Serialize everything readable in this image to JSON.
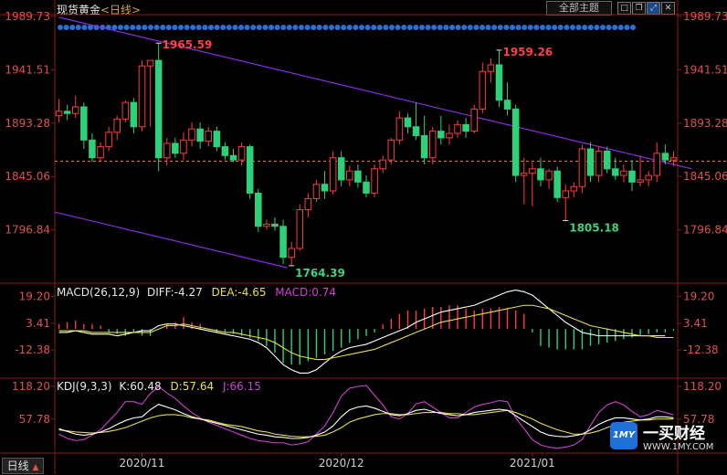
{
  "header": {
    "title": "现货黄金",
    "period": "<日线>",
    "theme_button": "全部主题",
    "icons": [
      "square-icon",
      "restore-icon",
      "maximize-icon",
      "close-icon"
    ]
  },
  "footer": {
    "period_button": "日线",
    "period_arrow": "▲"
  },
  "colors": {
    "up": "#ff3b3b",
    "down": "#2ed07a",
    "price_text": "#e05050",
    "grid": "#8b1a1a",
    "diff": "#ffffff",
    "dea": "#e8e040",
    "macd": "#d040d0",
    "k": "#ffffff",
    "d": "#e8e040",
    "j": "#d040d0",
    "channel": "#8a2be2"
  },
  "chart_data": {
    "type": "candlestick",
    "main": {
      "title": "现货黄金",
      "y_ticks": [
        "1989.73",
        "1941.51",
        "1893.28",
        "1845.06",
        "1796.84"
      ],
      "ylim": [
        1748.62,
        1989.73
      ],
      "dashed_level": 1859,
      "annotations": [
        {
          "text": "1965.59",
          "value": 1965.59,
          "color": "#ff4040"
        },
        {
          "text": "1764.39",
          "value": 1764.39,
          "color": "#40d080"
        },
        {
          "text": "1959.26",
          "value": 1959.26,
          "color": "#ff4040"
        },
        {
          "text": "1805.18",
          "value": 1805.18,
          "color": "#40d080"
        }
      ],
      "candles": [
        {
          "o": 1900,
          "h": 1915,
          "l": 1894,
          "c": 1904
        },
        {
          "o": 1904,
          "h": 1910,
          "l": 1896,
          "c": 1902
        },
        {
          "o": 1902,
          "h": 1918,
          "l": 1898,
          "c": 1908
        },
        {
          "o": 1908,
          "h": 1912,
          "l": 1870,
          "c": 1878
        },
        {
          "o": 1878,
          "h": 1884,
          "l": 1858,
          "c": 1862
        },
        {
          "o": 1862,
          "h": 1876,
          "l": 1858,
          "c": 1872
        },
        {
          "o": 1872,
          "h": 1890,
          "l": 1868,
          "c": 1885
        },
        {
          "o": 1885,
          "h": 1900,
          "l": 1878,
          "c": 1897
        },
        {
          "o": 1897,
          "h": 1914,
          "l": 1894,
          "c": 1912
        },
        {
          "o": 1912,
          "h": 1916,
          "l": 1884,
          "c": 1890
        },
        {
          "o": 1890,
          "h": 1950,
          "l": 1886,
          "c": 1945
        },
        {
          "o": 1945,
          "h": 1950,
          "l": 1890,
          "c": 1950
        },
        {
          "o": 1950,
          "h": 1965.59,
          "l": 1850,
          "c": 1862
        },
        {
          "o": 1862,
          "h": 1880,
          "l": 1855,
          "c": 1875
        },
        {
          "o": 1875,
          "h": 1880,
          "l": 1862,
          "c": 1866
        },
        {
          "o": 1866,
          "h": 1885,
          "l": 1860,
          "c": 1878
        },
        {
          "o": 1878,
          "h": 1894,
          "l": 1872,
          "c": 1888
        },
        {
          "o": 1888,
          "h": 1894,
          "l": 1870,
          "c": 1877
        },
        {
          "o": 1877,
          "h": 1890,
          "l": 1872,
          "c": 1886
        },
        {
          "o": 1886,
          "h": 1890,
          "l": 1868,
          "c": 1872
        },
        {
          "o": 1872,
          "h": 1876,
          "l": 1860,
          "c": 1864
        },
        {
          "o": 1864,
          "h": 1870,
          "l": 1858,
          "c": 1860
        },
        {
          "o": 1860,
          "h": 1876,
          "l": 1855,
          "c": 1872
        },
        {
          "o": 1872,
          "h": 1874,
          "l": 1825,
          "c": 1830
        },
        {
          "o": 1830,
          "h": 1834,
          "l": 1795,
          "c": 1800
        },
        {
          "o": 1800,
          "h": 1806,
          "l": 1797,
          "c": 1802
        },
        {
          "o": 1802,
          "h": 1808,
          "l": 1796,
          "c": 1800
        },
        {
          "o": 1800,
          "h": 1806,
          "l": 1766,
          "c": 1772
        },
        {
          "o": 1772,
          "h": 1786,
          "l": 1764.39,
          "c": 1780
        },
        {
          "o": 1780,
          "h": 1820,
          "l": 1778,
          "c": 1815
        },
        {
          "o": 1815,
          "h": 1830,
          "l": 1808,
          "c": 1825
        },
        {
          "o": 1825,
          "h": 1842,
          "l": 1822,
          "c": 1838
        },
        {
          "o": 1838,
          "h": 1850,
          "l": 1825,
          "c": 1832
        },
        {
          "o": 1832,
          "h": 1868,
          "l": 1829,
          "c": 1862
        },
        {
          "o": 1862,
          "h": 1868,
          "l": 1836,
          "c": 1842
        },
        {
          "o": 1842,
          "h": 1855,
          "l": 1836,
          "c": 1850
        },
        {
          "o": 1850,
          "h": 1856,
          "l": 1835,
          "c": 1840
        },
        {
          "o": 1840,
          "h": 1846,
          "l": 1826,
          "c": 1830
        },
        {
          "o": 1830,
          "h": 1856,
          "l": 1826,
          "c": 1852
        },
        {
          "o": 1852,
          "h": 1864,
          "l": 1848,
          "c": 1860
        },
        {
          "o": 1860,
          "h": 1880,
          "l": 1856,
          "c": 1878
        },
        {
          "o": 1878,
          "h": 1904,
          "l": 1874,
          "c": 1898
        },
        {
          "o": 1898,
          "h": 1902,
          "l": 1884,
          "c": 1890
        },
        {
          "o": 1890,
          "h": 1912,
          "l": 1878,
          "c": 1882
        },
        {
          "o": 1882,
          "h": 1900,
          "l": 1856,
          "c": 1862
        },
        {
          "o": 1862,
          "h": 1890,
          "l": 1856,
          "c": 1886
        },
        {
          "o": 1886,
          "h": 1900,
          "l": 1874,
          "c": 1880
        },
        {
          "o": 1880,
          "h": 1892,
          "l": 1874,
          "c": 1884
        },
        {
          "o": 1884,
          "h": 1896,
          "l": 1880,
          "c": 1892
        },
        {
          "o": 1892,
          "h": 1898,
          "l": 1880,
          "c": 1886
        },
        {
          "o": 1886,
          "h": 1910,
          "l": 1884,
          "c": 1906
        },
        {
          "o": 1906,
          "h": 1948,
          "l": 1902,
          "c": 1940
        },
        {
          "o": 1940,
          "h": 1952,
          "l": 1930,
          "c": 1946
        },
        {
          "o": 1946,
          "h": 1959.26,
          "l": 1908,
          "c": 1914
        },
        {
          "o": 1914,
          "h": 1930,
          "l": 1900,
          "c": 1906
        },
        {
          "o": 1906,
          "h": 1910,
          "l": 1840,
          "c": 1846
        },
        {
          "o": 1846,
          "h": 1862,
          "l": 1820,
          "c": 1848
        },
        {
          "o": 1848,
          "h": 1858,
          "l": 1818,
          "c": 1852
        },
        {
          "o": 1852,
          "h": 1862,
          "l": 1836,
          "c": 1842
        },
        {
          "o": 1842,
          "h": 1852,
          "l": 1834,
          "c": 1850
        },
        {
          "o": 1850,
          "h": 1854,
          "l": 1822,
          "c": 1826
        },
        {
          "o": 1826,
          "h": 1838,
          "l": 1805.18,
          "c": 1832
        },
        {
          "o": 1832,
          "h": 1840,
          "l": 1826,
          "c": 1836
        },
        {
          "o": 1836,
          "h": 1874,
          "l": 1830,
          "c": 1870
        },
        {
          "o": 1870,
          "h": 1876,
          "l": 1840,
          "c": 1846
        },
        {
          "o": 1846,
          "h": 1872,
          "l": 1840,
          "c": 1868
        },
        {
          "o": 1868,
          "h": 1872,
          "l": 1848,
          "c": 1852
        },
        {
          "o": 1852,
          "h": 1862,
          "l": 1842,
          "c": 1846
        },
        {
          "o": 1846,
          "h": 1856,
          "l": 1840,
          "c": 1850
        },
        {
          "o": 1850,
          "h": 1860,
          "l": 1832,
          "c": 1840
        },
        {
          "o": 1840,
          "h": 1864,
          "l": 1836,
          "c": 1842
        },
        {
          "o": 1842,
          "h": 1850,
          "l": 1836,
          "c": 1846
        },
        {
          "o": 1846,
          "h": 1876,
          "l": 1840,
          "c": 1866
        },
        {
          "o": 1866,
          "h": 1874,
          "l": 1856,
          "c": 1860
        },
        {
          "o": 1860,
          "h": 1868,
          "l": 1854,
          "c": 1862
        }
      ]
    },
    "macd": {
      "title": "MACD(26,12,9)",
      "diff_label": "DIFF:-4.27",
      "dea_label": "DEA:-4.65",
      "macd_label": "MACD:0.74",
      "y_ticks": [
        "19.20",
        "3.41",
        "-12.38"
      ],
      "ylim": [
        -29,
        26
      ],
      "hist": [
        3,
        4,
        5,
        3,
        3,
        2,
        -2,
        -3,
        -4,
        -2,
        -4,
        -4,
        0,
        3,
        4,
        7,
        4,
        3,
        0,
        -2,
        -2,
        -3,
        -4,
        -5,
        -7,
        -10,
        -14,
        -20,
        -21,
        -21,
        -19,
        -17,
        -15,
        -13,
        -11,
        -8,
        -6,
        -4,
        -2,
        3,
        6,
        9,
        11,
        11,
        12,
        13,
        13,
        14,
        14,
        12,
        11,
        12,
        12,
        13,
        12,
        11,
        9,
        -2,
        -10,
        -11,
        -12,
        -12,
        -12,
        -12,
        -10,
        -9,
        -8,
        -7,
        -6,
        -5,
        -4,
        -3,
        -2,
        -2,
        -1
      ],
      "diff": [
        -2,
        -2,
        -1,
        -2,
        -3,
        -3,
        -3,
        -4,
        -3,
        -2,
        -1,
        -1,
        2,
        3,
        3,
        2,
        1,
        0,
        -1,
        -2,
        -3,
        -4,
        -5,
        -6,
        -8,
        -11,
        -16,
        -21,
        -24,
        -26,
        -26,
        -24,
        -20,
        -16,
        -13,
        -11,
        -10,
        -9,
        -7,
        -5,
        -3,
        -1,
        1,
        4,
        6,
        8,
        10,
        11,
        12,
        13,
        14,
        16,
        18,
        20,
        22,
        23,
        22,
        20,
        16,
        12,
        8,
        4,
        1,
        -2,
        -3,
        -4,
        -4,
        -4,
        -4,
        -4,
        -4,
        -4,
        -4,
        -4
      ],
      "dea": [
        -1,
        -1,
        -1,
        -1,
        -2,
        -2,
        -2,
        -2,
        -2,
        -2,
        -2,
        -2,
        0,
        2,
        2,
        3,
        2,
        1,
        0,
        -1,
        -2,
        -2,
        -3,
        -4,
        -5,
        -6,
        -8,
        -11,
        -14,
        -16,
        -17,
        -18,
        -18,
        -17,
        -16,
        -15,
        -14,
        -13,
        -12,
        -10,
        -8,
        -6,
        -4,
        -2,
        0,
        2,
        4,
        5,
        6,
        7,
        8,
        9,
        10,
        11,
        12,
        13,
        14,
        14,
        13,
        12,
        10,
        8,
        6,
        4,
        2,
        1,
        0,
        -1,
        -2,
        -3,
        -4,
        -4,
        -5,
        -5,
        -5
      ]
    },
    "kdj": {
      "title": "KDJ(9,3,3)",
      "k_label": "K:60.48",
      "d_label": "D:57.64",
      "j_label": "J:66.15",
      "y_ticks": [
        "118.20",
        "57.78"
      ],
      "ylim": [
        -5,
        130
      ],
      "k": [
        40,
        35,
        30,
        28,
        30,
        34,
        40,
        48,
        55,
        60,
        62,
        75,
        85,
        80,
        75,
        68,
        62,
        58,
        54,
        50,
        46,
        42,
        38,
        34,
        30,
        28,
        25,
        24,
        22,
        22,
        24,
        28,
        34,
        45,
        62,
        75,
        80,
        82,
        78,
        72,
        66,
        64,
        68,
        74,
        76,
        72,
        68,
        66,
        64,
        66,
        70,
        72,
        74,
        76,
        74,
        64,
        54,
        44,
        34,
        28,
        26,
        25,
        27,
        30,
        38,
        48,
        55,
        60,
        60,
        58,
        56,
        58,
        62,
        62,
        60
      ],
      "d": [
        38,
        36,
        34,
        33,
        32,
        33,
        35,
        38,
        42,
        48,
        54,
        60,
        64,
        66,
        66,
        64,
        60,
        58,
        56,
        52,
        48,
        46,
        44,
        40,
        36,
        34,
        30,
        28,
        26,
        25,
        25,
        26,
        28,
        34,
        42,
        52,
        58,
        62,
        66,
        68,
        68,
        66,
        66,
        68,
        70,
        70,
        70,
        68,
        68,
        66,
        66,
        68,
        70,
        72,
        74,
        70,
        64,
        58,
        50,
        44,
        38,
        34,
        30,
        30,
        32,
        36,
        42,
        48,
        52,
        54,
        56,
        56,
        58,
        58,
        58
      ],
      "j": [
        30,
        22,
        18,
        20,
        28,
        38,
        54,
        70,
        90,
        90,
        85,
        105,
        118,
        106,
        96,
        82,
        70,
        60,
        52,
        46,
        40,
        34,
        28,
        22,
        18,
        16,
        14,
        14,
        10,
        12,
        16,
        30,
        45,
        70,
        100,
        115,
        118,
        120,
        102,
        84,
        62,
        58,
        68,
        86,
        90,
        80,
        70,
        60,
        60,
        70,
        80,
        85,
        88,
        92,
        90,
        60,
        40,
        20,
        10,
        6,
        4,
        6,
        10,
        20,
        46,
        70,
        84,
        90,
        84,
        72,
        62,
        66,
        74,
        70,
        66
      ]
    },
    "x_labels": [
      {
        "text": "2020/11",
        "index": 10
      },
      {
        "text": "2020/12",
        "index": 34
      },
      {
        "text": "2021/01",
        "index": 57
      }
    ],
    "brand": {
      "logo_text": "1MY",
      "name": "一买财经",
      "url": "WWW.1MY.COM"
    }
  }
}
